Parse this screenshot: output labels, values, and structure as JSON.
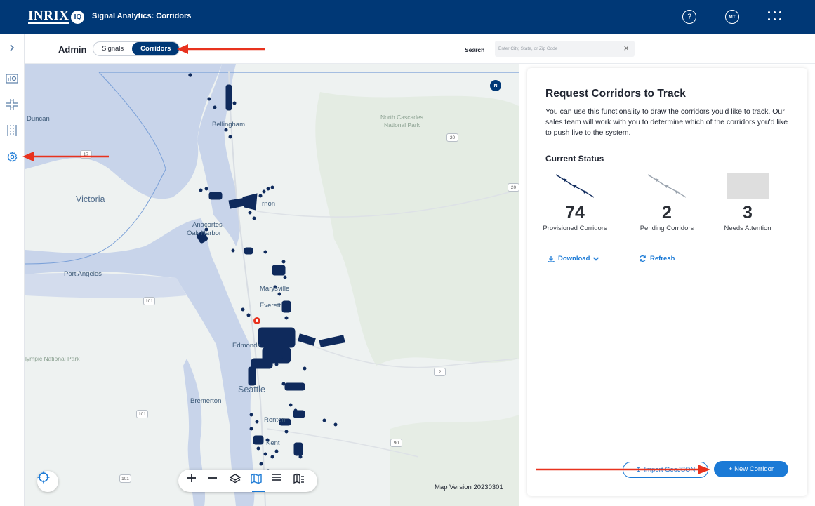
{
  "topbar": {
    "logo_text": "INRIX",
    "logo_badge": "IQ",
    "app_title": "Signal Analytics: Corridors",
    "help_glyph": "?",
    "avatar_initials": "MT"
  },
  "subheader": {
    "section": "Admin",
    "tabs": [
      {
        "label": "Signals",
        "active": false
      },
      {
        "label": "Corridors",
        "active": true
      }
    ],
    "search_label": "Search",
    "search_placeholder": "Enter City, State, or Zip Code",
    "search_clear": "×"
  },
  "sidebar": {
    "items": [
      {
        "icon": "chevron-right-icon"
      },
      {
        "icon": "dashboard-icon"
      },
      {
        "icon": "intersection-icon"
      },
      {
        "icon": "corridor-icon"
      },
      {
        "icon": "gear-icon"
      }
    ]
  },
  "map": {
    "labels": {
      "duncan": "Duncan",
      "victoria": "Victoria",
      "bellingham": "Bellingham",
      "north_cascades": "North Cascades\nNational Park",
      "anacortes": "Anacortes",
      "vernon": "rnon",
      "oak_harbor": "Oak Harbor",
      "port_angeles": "Port Angeles",
      "marysville": "Marysville",
      "everett": "Everett",
      "edmonds": "Edmonds",
      "olympic": "lympic National Park",
      "seattle": "Seattle",
      "bremerton": "Bremerton",
      "renton": "Renton",
      "kent": "Kent"
    },
    "shields": {
      "s20a": "20",
      "s20b": "20",
      "s101a": "101",
      "s101b": "101",
      "s101c": "101",
      "s2": "2",
      "s90": "90",
      "s17": "17"
    },
    "north_label": "N",
    "version": "Map Version 20230301",
    "toolbar": [
      "zoom-in",
      "zoom-out",
      "layers",
      "map-view",
      "list-view",
      "map-legend"
    ]
  },
  "panel": {
    "title": "Request Corridors to Track",
    "description": "You can use this functionality to draw the corridors you'd like to track. Our sales team will work with you to determine which of the corridors you'd like to push live to the system.",
    "status_title": "Current Status",
    "stats": [
      {
        "value": "74",
        "label": "Provisioned Corridors"
      },
      {
        "value": "2",
        "label": "Pending Corridors"
      },
      {
        "value": "3",
        "label": "Needs Attention"
      }
    ],
    "download_label": "Download",
    "refresh_label": "Refresh",
    "import_label": "Import GeoJSON",
    "new_corridor_label": "+  New Corridor"
  },
  "colors": {
    "brand_navy": "#003876",
    "accent_blue": "#1b7ad6",
    "annotation_red": "#e8321e"
  }
}
